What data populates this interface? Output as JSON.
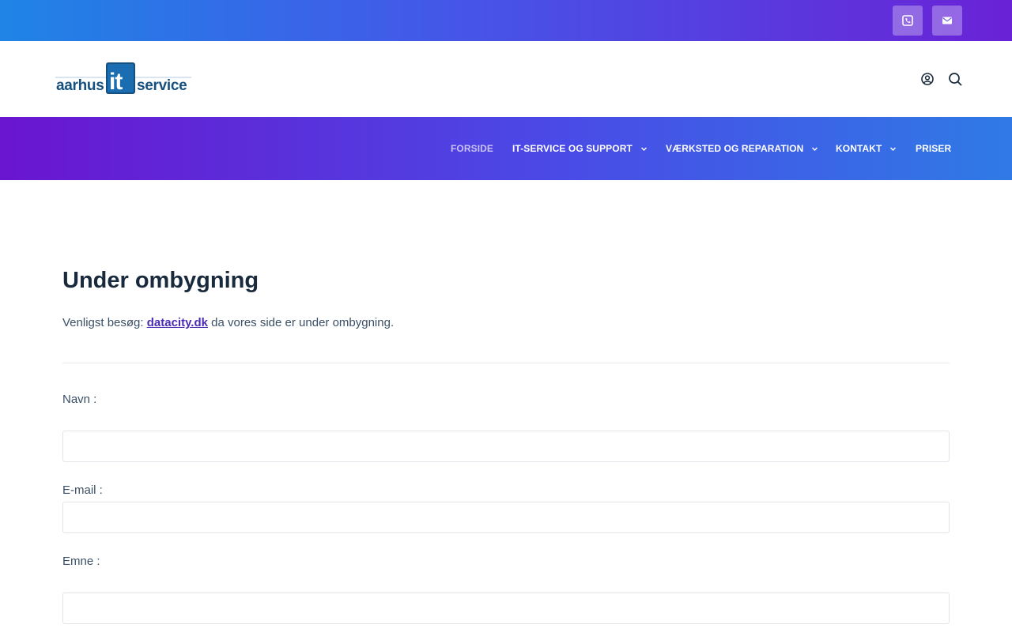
{
  "topbar": {
    "phone_icon": "phone-icon",
    "mail_icon": "mail-icon"
  },
  "header": {
    "logo": {
      "part1": "aarhus",
      "part2": "it",
      "part3": "service"
    },
    "account_icon": "account-icon",
    "search_icon": "search-icon"
  },
  "nav": {
    "items": [
      {
        "label": "FORSIDE",
        "has_dropdown": false,
        "active": true
      },
      {
        "label": "IT-SERVICE OG SUPPORT",
        "has_dropdown": true
      },
      {
        "label": "VÆRKSTED OG REPARATION",
        "has_dropdown": true
      },
      {
        "label": "KONTAKT",
        "has_dropdown": true
      },
      {
        "label": "PRISER",
        "has_dropdown": false
      }
    ]
  },
  "main": {
    "title": "Under ombygning",
    "intro_before": "Venligst besøg: ",
    "intro_link": "datacity.dk",
    "intro_after": " da vores side er under ombygning."
  },
  "form": {
    "name_label": "Navn :",
    "email_label": "E-mail :",
    "subject_label": "Emne :",
    "name_value": "",
    "email_value": "",
    "subject_value": ""
  },
  "colors": {
    "accent": "#4a2bb5",
    "title": "#192a3d",
    "text": "#3a4f66"
  }
}
